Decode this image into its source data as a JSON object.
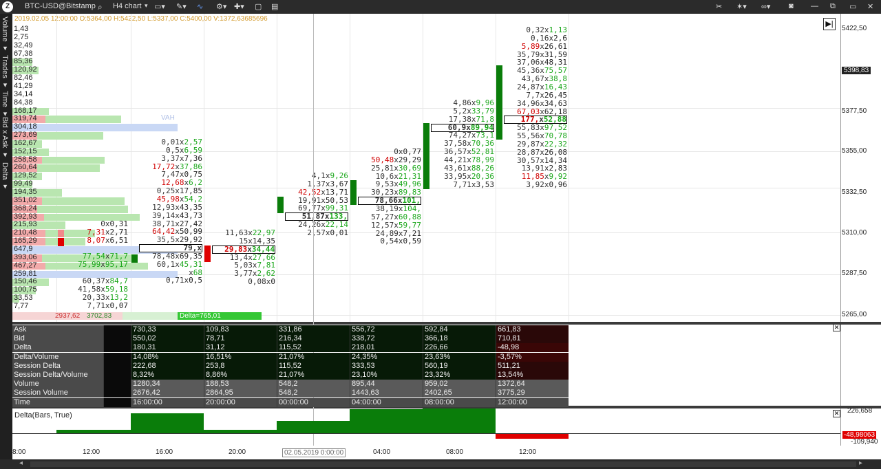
{
  "toolbar": {
    "symbol": "BTC-USD@Bitstamp",
    "timeframe": "H4 chart"
  },
  "left_tabs": [
    "Volume ▾",
    "Trades ▾",
    "Time ▾",
    "Bid x Ask ▾",
    "Delta ▾"
  ],
  "ohlc": "2019.02.05 12:00:00 O:5364,00 H:5422,50 L:5337,00 C:5400,00 V:1372,63685696",
  "vah_label": "VAH",
  "profile_rows": [
    {
      "v": "1,43",
      "bid": 0,
      "ask": 0
    },
    {
      "v": "2,75",
      "bid": 0,
      "ask": 0
    },
    {
      "v": "32,49",
      "bid": 0,
      "ask": 0
    },
    {
      "v": "67,38",
      "bid": 0,
      "ask": 0
    },
    {
      "v": "85,36",
      "bid": 0,
      "ask": 0.12
    },
    {
      "v": "120,92",
      "bid": 0,
      "ask": 0.16
    },
    {
      "v": "82,46",
      "bid": 0,
      "ask": 0
    },
    {
      "v": "41,29",
      "bid": 0,
      "ask": 0
    },
    {
      "v": "34,14",
      "bid": 0,
      "ask": 0
    },
    {
      "v": "84,38",
      "bid": 0,
      "ask": 0
    },
    {
      "v": "168,17",
      "bid": 0,
      "ask": 0.22
    },
    {
      "v": "319,74",
      "bid": 0.2,
      "ask": 0.46
    },
    {
      "v": "304,18",
      "bid": 0,
      "ask": 0,
      "poc": "blue"
    },
    {
      "v": "273,69",
      "bid": 0.15,
      "ask": 0.4
    },
    {
      "v": "162,67",
      "bid": 0,
      "ask": 0.18
    },
    {
      "v": "152,15",
      "bid": 0,
      "ask": 0.22
    },
    {
      "v": "258,58",
      "bid": 0.18,
      "ask": 0.38
    },
    {
      "v": "260,64",
      "bid": 0.15,
      "ask": 0.38
    },
    {
      "v": "129,52",
      "bid": 0,
      "ask": 0.18
    },
    {
      "v": "99,49",
      "bid": 0,
      "ask": 0.12
    },
    {
      "v": "194,35",
      "bid": 0,
      "ask": 0.3
    },
    {
      "v": "351,02",
      "bid": 0.18,
      "ask": 0.5
    },
    {
      "v": "368,24",
      "bid": 0.15,
      "ask": 0.55
    },
    {
      "v": "392,93",
      "bid": 0.19,
      "ask": 0.58
    },
    {
      "v": "215,93",
      "bid": 0,
      "ask": 0.32
    },
    {
      "v": "210,48",
      "bid": 0.2,
      "ask": 0.3
    },
    {
      "v": "165,29",
      "bid": 0.2,
      "ask": 0.24
    },
    {
      "v": "647,9",
      "bid": 0,
      "ask": 0,
      "poc": "blue"
    },
    {
      "v": "393,06",
      "bid": 0.18,
      "ask": 0.56
    },
    {
      "v": "467,27",
      "bid": 0.2,
      "ask": 0.62
    },
    {
      "v": "259,81",
      "bid": 0,
      "ask": 0,
      "poc": "blue2"
    },
    {
      "v": "150,46",
      "bid": 0,
      "ask": 0.22
    },
    {
      "v": "100,75",
      "bid": 0,
      "ask": 0.14
    },
    {
      "v": "33,53",
      "bid": 0,
      "ask": 0.04
    },
    {
      "v": "7,77",
      "bid": 0,
      "ask": 0
    }
  ],
  "profile_totals": {
    "bid": "2937,62",
    "ask": "3702,83",
    "delta": "Delta=765,01"
  },
  "price_axis": [
    "5422,50",
    "5398,83",
    "5377,50",
    "5355,00",
    "5332,50",
    "5310,00",
    "5287,50",
    "5265,00"
  ],
  "candles": [
    {
      "type": "none",
      "cells": [
        {
          "a": "0",
          "b": "0,31"
        },
        {
          "a": "7,31",
          "b": "2,71",
          "ac": "r"
        },
        {
          "a": "8,07",
          "b": "6,51",
          "ac": "r"
        },
        {
          "a": "",
          "b": ""
        },
        {
          "a": "77,54",
          "b": "71,7",
          "ac": "g",
          "bc": "g"
        },
        {
          "a": "75,99",
          "b": "95,17",
          "ac": "g",
          "bc": "g"
        },
        {
          "a": "",
          "b": ""
        },
        {
          "a": "60,37",
          "b": "84,7",
          "bc": "g"
        },
        {
          "a": "41,58",
          "b": "59,18",
          "bc": "g"
        },
        {
          "a": "20,33",
          "b": "13,2",
          "bc": "g"
        },
        {
          "a": "7,71",
          "b": "0,07"
        }
      ]
    },
    {
      "type": "c1",
      "cells": [
        {
          "a": "0,01",
          "b": "2,57",
          "bc": "g"
        },
        {
          "a": "0,5",
          "b": "6,59",
          "bc": "g"
        },
        {
          "a": "3,37",
          "b": "7,36"
        },
        {
          "a": "17,72",
          "b": "37,86",
          "ac": "r",
          "bc": "g"
        },
        {
          "a": "7,47",
          "b": "0,75"
        },
        {
          "a": "12,68",
          "b": "6,2",
          "ac": "r",
          "bc": "g"
        },
        {
          "a": "0,25",
          "b": "17,85"
        },
        {
          "a": "45,98",
          "b": "54,2",
          "ac": "r",
          "bc": "g"
        },
        {
          "a": "12,93",
          "b": "43,35"
        },
        {
          "a": "39,14",
          "b": "43,73"
        },
        {
          "a": "38,71",
          "b": "27,42"
        },
        {
          "a": "64,42",
          "b": "50,99",
          "ac": "r"
        },
        {
          "a": "35,5",
          "b": "29,92"
        },
        {
          "a": "79,",
          "b": "",
          "bx": true
        },
        {
          "a": "78,48",
          "b": "69,35"
        },
        {
          "a": "60,1",
          "b": "45,31",
          "bc": "g"
        },
        {
          "a": "",
          "b": "68",
          "bc": "g"
        },
        {
          "a": "0,71",
          "b": "0,5"
        }
      ]
    },
    {
      "type": "c2",
      "cells": [
        {
          "a": "11,63",
          "b": "22,97",
          "bc": "g"
        },
        {
          "a": "15",
          "b": "14,35"
        },
        {
          "a": "29,83",
          "b": "34,44",
          "ac": "r",
          "bc": "g",
          "bx": true
        },
        {
          "a": "13,4",
          "b": "27,66",
          "bc": "g"
        },
        {
          "a": "5,03",
          "b": "7,81",
          "bc": "g"
        },
        {
          "a": "3,77",
          "b": "2,62",
          "bc": "g"
        },
        {
          "a": "0,08",
          "b": "0"
        }
      ]
    },
    {
      "type": "c3",
      "cells": [
        {
          "a": "4,1",
          "b": "9,26",
          "bc": "g"
        },
        {
          "a": "1,37",
          "b": "3,67"
        },
        {
          "a": "42,52",
          "b": "13,71",
          "ac": "r"
        },
        {
          "a": "19,91",
          "b": "50,53"
        },
        {
          "a": "69,77",
          "b": "99,31",
          "bc": "g"
        },
        {
          "a": "51,87",
          "b": "133,",
          "bc": "g",
          "bx": true
        },
        {
          "a": "24,26",
          "b": "22,14",
          "bc": "g"
        },
        {
          "a": "2,57",
          "b": "0,01"
        }
      ]
    },
    {
      "type": "c4",
      "cells": [
        {
          "a": "0",
          "b": "0,77"
        },
        {
          "a": "50,48",
          "b": "29,29",
          "ac": "r"
        },
        {
          "a": "25,81",
          "b": "30,69",
          "bc": "g"
        },
        {
          "a": "10,6",
          "b": "21,31",
          "bc": "g"
        },
        {
          "a": "9,53",
          "b": "49,96",
          "bc": "g"
        },
        {
          "a": "30,23",
          "b": "89,83",
          "bc": "g"
        },
        {
          "a": "78,66",
          "b": "101,",
          "bc": "g",
          "bx": true
        },
        {
          "a": "38,19",
          "b": "104,",
          "bc": "g"
        },
        {
          "a": "57,27",
          "b": "60,88",
          "bc": "g"
        },
        {
          "a": "12,57",
          "b": "59,77",
          "bc": "g"
        },
        {
          "a": "24,89",
          "b": "7,21"
        },
        {
          "a": "0,54",
          "b": "0,59"
        }
      ]
    },
    {
      "type": "c5",
      "cells": [
        {
          "a": "4,86",
          "b": "9,96",
          "bc": "g"
        },
        {
          "a": "5,2",
          "b": "33,79",
          "bc": "g"
        },
        {
          "a": "17,38",
          "b": "71,8",
          "bc": "g"
        },
        {
          "a": "60,9",
          "b": "89,94",
          "bc": "g",
          "bx": true
        },
        {
          "a": "74,27",
          "b": "73,1",
          "bc": "g"
        },
        {
          "a": "37,58",
          "b": "70,36",
          "bc": "g"
        },
        {
          "a": "36,57",
          "b": "52,81",
          "bc": "g"
        },
        {
          "a": "44,21",
          "b": "78,99",
          "bc": "g"
        },
        {
          "a": "43,61",
          "b": "88,26",
          "bc": "g"
        },
        {
          "a": "33,95",
          "b": "20,36",
          "bc": "g"
        },
        {
          "a": "7,71",
          "b": "3,53"
        }
      ]
    },
    {
      "type": "c6",
      "cells": [
        {
          "a": "0,32",
          "b": "1,13",
          "bc": "g"
        },
        {
          "a": "0,16",
          "b": "2,6"
        },
        {
          "a": "5,89",
          "b": "26,61",
          "ac": "r"
        },
        {
          "a": "35,79",
          "b": "31,59"
        },
        {
          "a": "37,06",
          "b": "48,31"
        },
        {
          "a": "45,36",
          "b": "75,57",
          "bc": "g"
        },
        {
          "a": "43,67",
          "b": "38,8",
          "bc": "g"
        },
        {
          "a": "24,87",
          "b": "16,43",
          "bc": "g"
        },
        {
          "a": "7,7",
          "b": "26,45"
        },
        {
          "a": "34,96",
          "b": "34,63"
        },
        {
          "a": "67,03",
          "b": "62,18",
          "ac": "r"
        },
        {
          "a": "177,",
          "b": "52,88",
          "ac": "r",
          "bc": "g",
          "bx": true
        },
        {
          "a": "55,83",
          "b": "97,52",
          "bc": "g"
        },
        {
          "a": "55,56",
          "b": "70,78",
          "bc": "g"
        },
        {
          "a": "29,87",
          "b": "22,32",
          "bc": "g"
        },
        {
          "a": "28,87",
          "b": "26,08"
        },
        {
          "a": "30,57",
          "b": "14,34"
        },
        {
          "a": "13,91",
          "b": "2,83"
        },
        {
          "a": "11,85",
          "b": "9,92",
          "ac": "r",
          "bc": "g"
        },
        {
          "a": "3,92",
          "b": "0,96"
        }
      ]
    }
  ],
  "stats": {
    "labels": [
      "Ask",
      "Bid",
      "Delta",
      "Delta/Volume",
      "Session Delta",
      "Session Delta/Volume",
      "Volume",
      "Session Volume",
      "Time"
    ],
    "columns": [
      [
        "730,33",
        "550,02",
        "180,31",
        "14,08%",
        "222,68",
        "8,32%",
        "1280,34",
        "2676,42",
        "16:00:00"
      ],
      [
        "109,83",
        "78,71",
        "31,12",
        "16,51%",
        "253,8",
        "8,86%",
        "188,53",
        "2864,95",
        "20:00:00"
      ],
      [
        "331,86",
        "216,34",
        "115,52",
        "21,07%",
        "115,52",
        "21,07%",
        "548,2",
        "548,2",
        "00:00:00"
      ],
      [
        "556,72",
        "338,72",
        "218,01",
        "24,35%",
        "333,53",
        "23,10%",
        "895,44",
        "1443,63",
        "04:00:00"
      ],
      [
        "592,84",
        "366,18",
        "226,66",
        "23,63%",
        "560,19",
        "23,32%",
        "959,02",
        "2402,65",
        "08:00:00"
      ],
      [
        "661,83",
        "710,81",
        "-48,98",
        "-3,57%",
        "511,21",
        "13,54%",
        "1372,64",
        "3775,29",
        "12:00:00"
      ]
    ]
  },
  "delta_panel": {
    "title": "Delta(Bars, True)",
    "axis_top": "226,658",
    "axis_bottom": "-109,940",
    "last": "-48,98063",
    "values": [
      31.12,
      180.31,
      31.12,
      115.52,
      218.01,
      226.66,
      -48.98
    ]
  },
  "time_axis": [
    "8:00",
    "12:00",
    "16:00",
    "20:00",
    "02.05.2019 0:00:00",
    "04:00",
    "08:00",
    "12:00"
  ],
  "colors": {
    "green": "#0a7d0a",
    "red": "#e00000",
    "bidbar": "#f2aaaa",
    "askbar": "#b9e6b0",
    "poc": "#c9d8f5"
  }
}
